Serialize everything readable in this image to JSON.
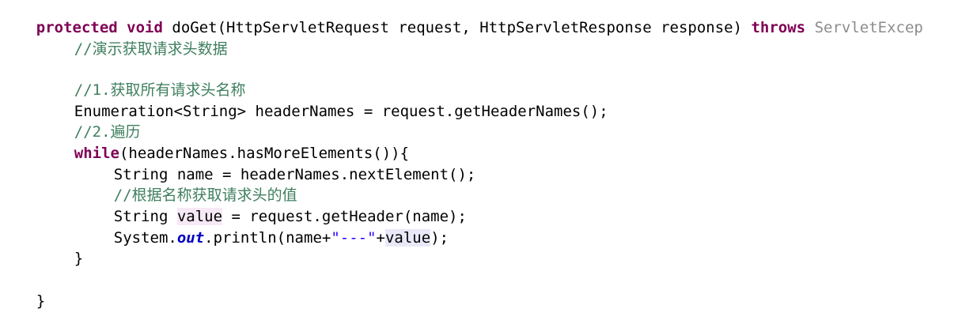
{
  "code": {
    "l1": {
      "kw1": "protected",
      "kw2": "void",
      "rest": " doGet(HttpServletRequest request, HttpServletResponse response) ",
      "kw3": "throws",
      "trunc": " ServletExcep"
    },
    "l2": {
      "comment": "//演示获取请求头数据"
    },
    "l4": {
      "comment": "//1.获取所有请求头名称"
    },
    "l5": {
      "text": "Enumeration<String> headerNames = request.getHeaderNames();"
    },
    "l6": {
      "comment": "//2.遍历"
    },
    "l7": {
      "kw": "while",
      "rest": "(headerNames.hasMoreElements()){"
    },
    "l8": {
      "text": "String name = headerNames.nextElement();"
    },
    "l9": {
      "comment": "//根据名称获取请求头的值"
    },
    "l10": {
      "pre": "String ",
      "hl": "value",
      "post": " = request.getHeader(name);"
    },
    "l11": {
      "pre": "System.",
      "static": "out",
      "mid": ".println(name+",
      "str": "\"---\"",
      "plus": "+",
      "hl": "value",
      "post": ");"
    },
    "l12": {
      "text": "}"
    },
    "l14": {
      "text": "}"
    }
  }
}
